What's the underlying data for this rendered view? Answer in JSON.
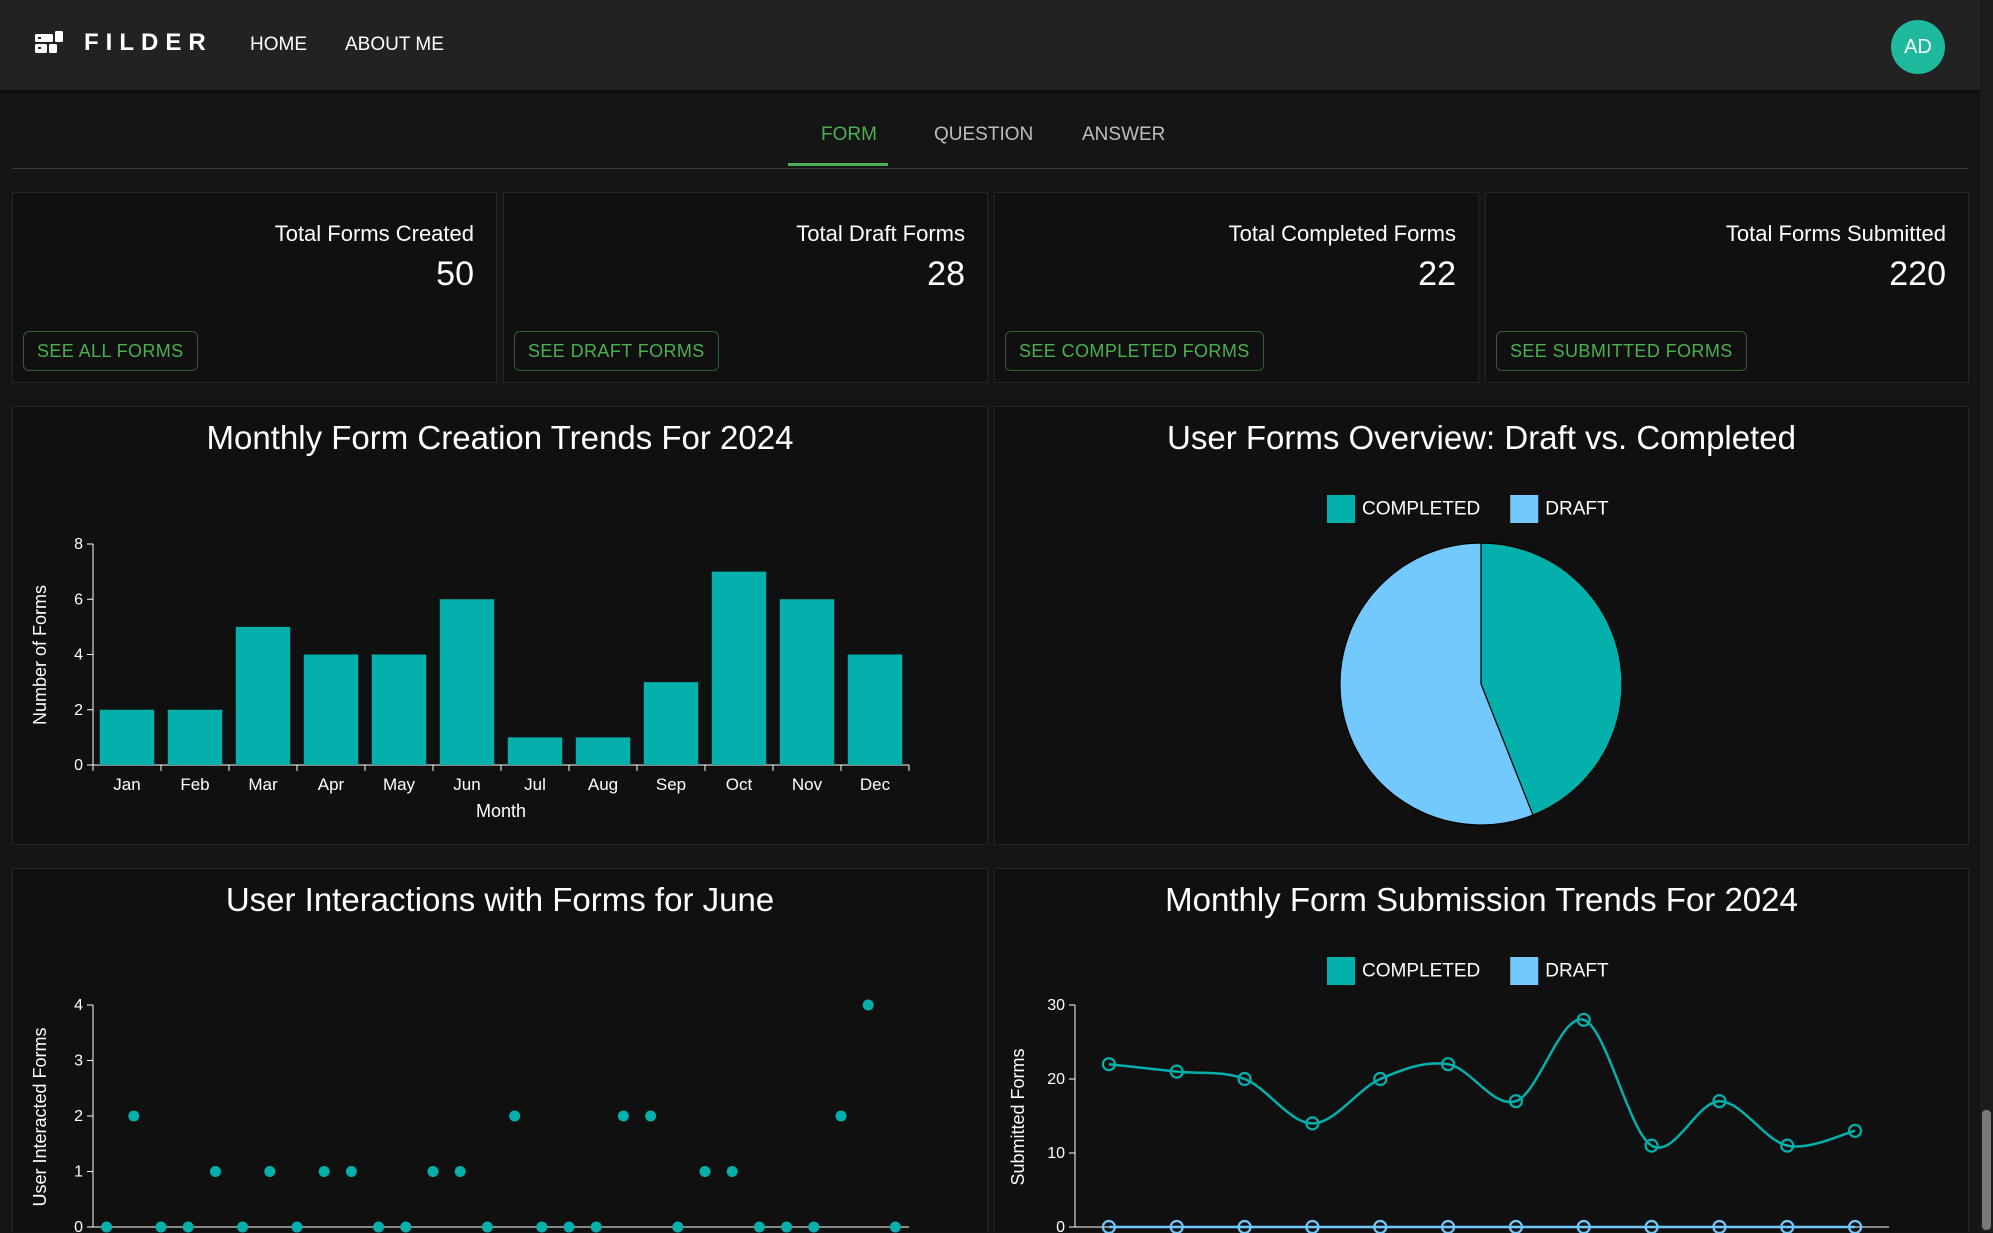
{
  "app": {
    "brand": "FILDER",
    "nav": [
      "HOME",
      "ABOUT ME"
    ],
    "avatar": "AD"
  },
  "tabs": [
    "FORM",
    "QUESTION",
    "ANSWER"
  ],
  "stats": [
    {
      "title": "Total Forms Created",
      "value": "50",
      "button": "SEE ALL FORMS"
    },
    {
      "title": "Total Draft Forms",
      "value": "28",
      "button": "SEE DRAFT FORMS"
    },
    {
      "title": "Total Completed Forms",
      "value": "22",
      "button": "SEE COMPLETED FORMS"
    },
    {
      "title": "Total Forms Submitted",
      "value": "220",
      "button": "SEE SUBMITTED FORMS"
    }
  ],
  "colors": {
    "accent": "#4caf50",
    "teal": "#03b0ac",
    "light_blue": "#73c9fe",
    "avatar": "#1fb99d"
  },
  "chart_data": [
    {
      "type": "bar",
      "title": "Monthly Form Creation Trends For 2024",
      "xlabel": "Month",
      "ylabel": "Number of Forms",
      "categories": [
        "Jan",
        "Feb",
        "Mar",
        "Apr",
        "May",
        "Jun",
        "Jul",
        "Aug",
        "Sep",
        "Oct",
        "Nov",
        "Dec"
      ],
      "values": [
        2,
        2,
        5,
        4,
        4,
        6,
        1,
        1,
        3,
        7,
        6,
        4
      ],
      "ylim": [
        0,
        8
      ],
      "yticks": [
        0,
        2,
        4,
        6,
        8
      ],
      "grid": false
    },
    {
      "type": "pie",
      "title": "User Forms Overview: Draft vs. Completed",
      "legend": [
        "COMPLETED",
        "DRAFT"
      ],
      "legend_position": "top",
      "values": [
        22,
        28
      ]
    },
    {
      "type": "scatter",
      "title": "User Interactions with Forms for June",
      "ylabel": "User Interacted Forms",
      "ylim": [
        0,
        4
      ],
      "yticks": [
        0,
        1,
        2,
        3,
        4
      ],
      "x": [
        1,
        2,
        3,
        4,
        5,
        6,
        7,
        8,
        9,
        10,
        11,
        12,
        13,
        14,
        15,
        16,
        17,
        18,
        19,
        20,
        21,
        22,
        23,
        24,
        25,
        26,
        27,
        28,
        29,
        30
      ],
      "values": [
        0,
        2,
        0,
        0,
        1,
        0,
        1,
        0,
        1,
        1,
        0,
        0,
        1,
        1,
        0,
        2,
        0,
        0,
        0,
        2,
        2,
        0,
        1,
        1,
        0,
        0,
        0,
        2,
        4,
        0
      ],
      "grid": false
    },
    {
      "type": "line",
      "title": "Monthly Form Submission Trends For 2024",
      "ylabel": "Submitted Forms",
      "legend": [
        "COMPLETED",
        "DRAFT"
      ],
      "legend_position": "top",
      "ylim": [
        0,
        30
      ],
      "yticks": [
        0,
        10,
        20,
        30
      ],
      "series": [
        {
          "name": "COMPLETED",
          "values": [
            22,
            21,
            20,
            14,
            20,
            22,
            17,
            28,
            11,
            17,
            11,
            13
          ]
        },
        {
          "name": "DRAFT",
          "values": [
            0,
            0,
            0,
            0,
            0,
            0,
            0,
            0,
            0,
            0,
            0,
            0
          ]
        }
      ],
      "grid": false
    }
  ]
}
